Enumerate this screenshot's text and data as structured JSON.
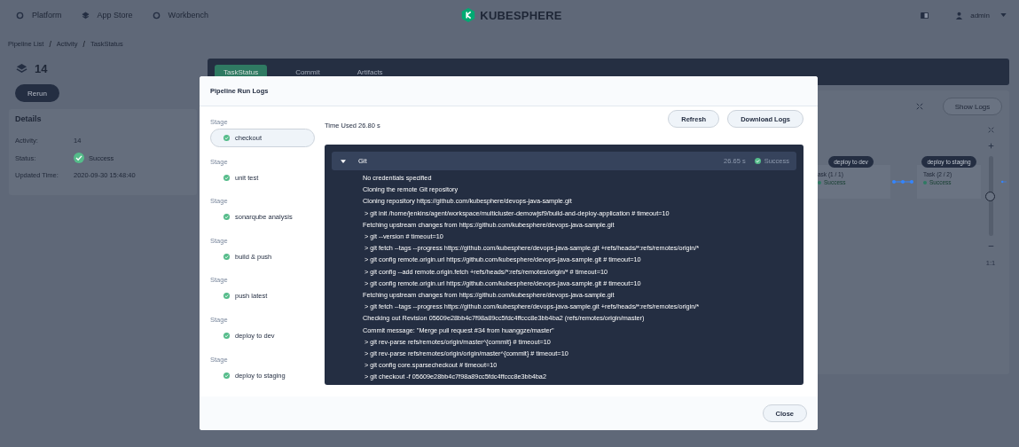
{
  "nav": {
    "items": [
      {
        "label": "Platform"
      },
      {
        "label": "App Store"
      },
      {
        "label": "Workbench"
      }
    ],
    "logo": "KUBESPHERE",
    "user": "admin"
  },
  "breadcrumb": [
    {
      "kind": "link",
      "text": "Pipeline List"
    },
    {
      "kind": "separator",
      "text": "/"
    },
    {
      "kind": "link",
      "text": "Activity"
    },
    {
      "kind": "separator",
      "text": "/"
    },
    {
      "kind": "link",
      "text": "TaskStatus"
    }
  ],
  "run": {
    "number": "14",
    "rerun": "Rerun"
  },
  "details": {
    "title": "Details",
    "rows": [
      {
        "label": "Activity:",
        "value": "14",
        "kind": "text"
      },
      {
        "label": "Status:",
        "value": "Success",
        "kind": "status"
      },
      {
        "label": "Updated Time:",
        "value": "2020-09-30 15:48:40",
        "kind": "text"
      }
    ]
  },
  "tabs": [
    {
      "label": "TaskStatus",
      "selected": true
    },
    {
      "label": "Commit",
      "selected": false
    },
    {
      "label": "Artifacts",
      "selected": false
    }
  ],
  "show_logs": "Show Logs",
  "graph": {
    "nodes": [
      {
        "stage": "deploy to dev",
        "task": "ask (1 / 1)",
        "status": "Success"
      },
      {
        "stage": "deploy to staging",
        "task": "Task (2 / 2)",
        "status": "Success"
      }
    ],
    "zoom": {
      "level": 0.5,
      "reset": "1:1"
    }
  },
  "dialog": {
    "title": "Pipeline Run Logs",
    "stages": [
      {
        "label": "Stage",
        "name": "checkout",
        "selected": true
      },
      {
        "label": "Stage",
        "name": "unit test",
        "selected": false
      },
      {
        "label": "Stage",
        "name": "sonarqube analysis",
        "selected": false
      },
      {
        "label": "Stage",
        "name": "build & push",
        "selected": false
      },
      {
        "label": "Stage",
        "name": "push latest",
        "selected": false
      },
      {
        "label": "Stage",
        "name": "deploy to dev",
        "selected": false
      },
      {
        "label": "Stage",
        "name": "deploy to staging",
        "selected": false
      }
    ],
    "time_used": "Time Used 26.80 s",
    "buttons": [
      "Refresh",
      "Download Logs"
    ],
    "step": {
      "name": "Git",
      "expanded": true,
      "duration": "26.65 s",
      "status": "Success",
      "lines": [
        "No credentials specified",
        "Cloning the remote Git repository",
        "Cloning repository https://github.com/kubesphere/devops-java-sample.git",
        " > git init /home/jenkins/agent/workspace/multicluster-demowjsf9/build-and-deploy-application # timeout=10",
        "Fetching upstream changes from https://github.com/kubesphere/devops-java-sample.git",
        " > git --version # timeout=10",
        " > git fetch --tags --progress https://github.com/kubesphere/devops-java-sample.git +refs/heads/*:refs/remotes/origin/*",
        " > git config remote.origin.url https://github.com/kubesphere/devops-java-sample.git # timeout=10",
        " > git config --add remote.origin.fetch +refs/heads/*:refs/remotes/origin/* # timeout=10",
        " > git config remote.origin.url https://github.com/kubesphere/devops-java-sample.git # timeout=10",
        "Fetching upstream changes from https://github.com/kubesphere/devops-java-sample.git",
        " > git fetch --tags --progress https://github.com/kubesphere/devops-java-sample.git +refs/heads/*:refs/remotes/origin/*",
        "Checking out Revision 05609e28bb4c7f98a89cc5fdc4ffccc8e3bb4ba2 (refs/remotes/origin/master)",
        "Commit message: \"Merge pull request #34 from huanggze/master\"",
        " > git rev-parse refs/remotes/origin/master^{commit} # timeout=10",
        " > git rev-parse refs/remotes/origin/origin/master^{commit} # timeout=10",
        " > git config core.sparsecheckout # timeout=10",
        " > git checkout -f 05609e28bb4c7f98a89cc5fdc4ffccc8e3bb4ba2"
      ]
    },
    "close": "Close"
  }
}
